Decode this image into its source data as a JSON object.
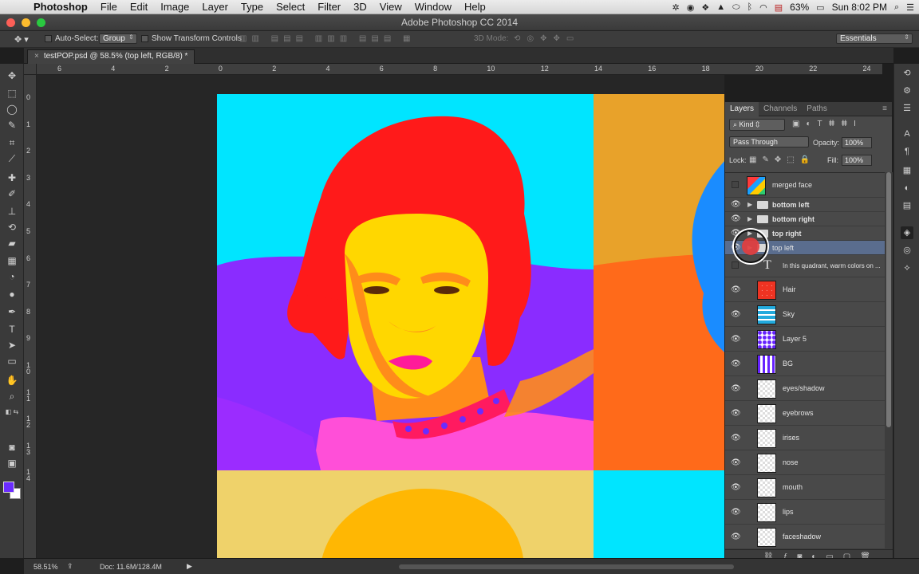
{
  "menubar": {
    "app_name": "Photoshop",
    "items": [
      "File",
      "Edit",
      "Image",
      "Layer",
      "Type",
      "Select",
      "Filter",
      "3D",
      "View",
      "Window",
      "Help"
    ],
    "battery": "63%",
    "clock": "Sun 8:02 PM",
    "icons": [
      "bolt-icon",
      "record-icon",
      "dropbox-icon",
      "drive-icon",
      "bluetooth-icon",
      "wifi-icon",
      "flag-icon",
      "battery-icon",
      "search-icon",
      "list-icon"
    ]
  },
  "titlebar": {
    "title": "Adobe Photoshop CC 2014"
  },
  "options": {
    "auto_select_label": "Auto-Select:",
    "auto_select_value": "Group",
    "show_transform_label": "Show Transform Controls",
    "mode_3d_label": "3D Mode:",
    "workspace": "Essentials"
  },
  "document": {
    "tab_label": "testPOP.psd @ 58.5% (top left, RGB/8) *"
  },
  "ruler": {
    "top_labels": [
      "6",
      "4",
      "2",
      "0",
      "2",
      "4",
      "6",
      "8",
      "10",
      "12",
      "14",
      "16",
      "18",
      "20",
      "22",
      "24"
    ],
    "left_labels": [
      "0",
      "1",
      "2",
      "3",
      "4",
      "5",
      "6",
      "7",
      "8",
      "9",
      "1\n0",
      "1\n1",
      "1\n2",
      "1\n3",
      "1\n4"
    ]
  },
  "layers_panel": {
    "tabs": [
      "Layers",
      "Channels",
      "Paths"
    ],
    "kind_label": "Kind",
    "blend_mode": "Pass Through",
    "opacity_label": "Opacity:",
    "opacity_value": "100%",
    "lock_label": "Lock:",
    "fill_label": "Fill:",
    "fill_value": "100%",
    "layers": [
      {
        "name": "merged face",
        "visible": false,
        "type": "image",
        "selected": false
      },
      {
        "name": "bottom left",
        "visible": true,
        "type": "group",
        "selected": false
      },
      {
        "name": "bottom right",
        "visible": true,
        "type": "group",
        "selected": false
      },
      {
        "name": "top right",
        "visible": true,
        "type": "group",
        "selected": false
      },
      {
        "name": "top left",
        "visible": true,
        "type": "group",
        "selected": true
      },
      {
        "name": "In this quadrant, warm colors on ...",
        "visible": false,
        "type": "text",
        "selected": false
      },
      {
        "name": "Hair",
        "visible": true,
        "type": "image",
        "selected": false
      },
      {
        "name": "Sky",
        "visible": true,
        "type": "image",
        "selected": false
      },
      {
        "name": "Layer 5",
        "visible": true,
        "type": "image",
        "selected": false
      },
      {
        "name": "BG",
        "visible": true,
        "type": "image",
        "selected": false
      },
      {
        "name": "eyes/shadow",
        "visible": true,
        "type": "image",
        "selected": false
      },
      {
        "name": "eyebrows",
        "visible": true,
        "type": "image",
        "selected": false
      },
      {
        "name": "irises",
        "visible": true,
        "type": "image",
        "selected": false
      },
      {
        "name": "nose",
        "visible": true,
        "type": "image",
        "selected": false
      },
      {
        "name": "mouth",
        "visible": true,
        "type": "image",
        "selected": false
      },
      {
        "name": "lips",
        "visible": true,
        "type": "image",
        "selected": false
      },
      {
        "name": "faceshadow",
        "visible": true,
        "type": "image",
        "selected": false
      }
    ],
    "footer_icons": [
      "link-icon",
      "fx-icon",
      "mask-icon",
      "adjustment-icon",
      "new-group-icon",
      "new-layer-icon",
      "trash-icon"
    ]
  },
  "status": {
    "zoom": "58.51%",
    "doc_size": "Doc: 11.6M/128.4M"
  },
  "colors": {
    "foreground": "#6b2cff",
    "background": "#ffffff",
    "art_cyan": "#00e5ff",
    "art_orange_bg": "#e8a22a",
    "art_red_hair": "#ff1a1a",
    "art_purple": "#8a2cff",
    "art_yellow_face": "#ffd700",
    "art_pale_yellow": "#efd26a",
    "selection_blue": "#5a6d8e"
  }
}
